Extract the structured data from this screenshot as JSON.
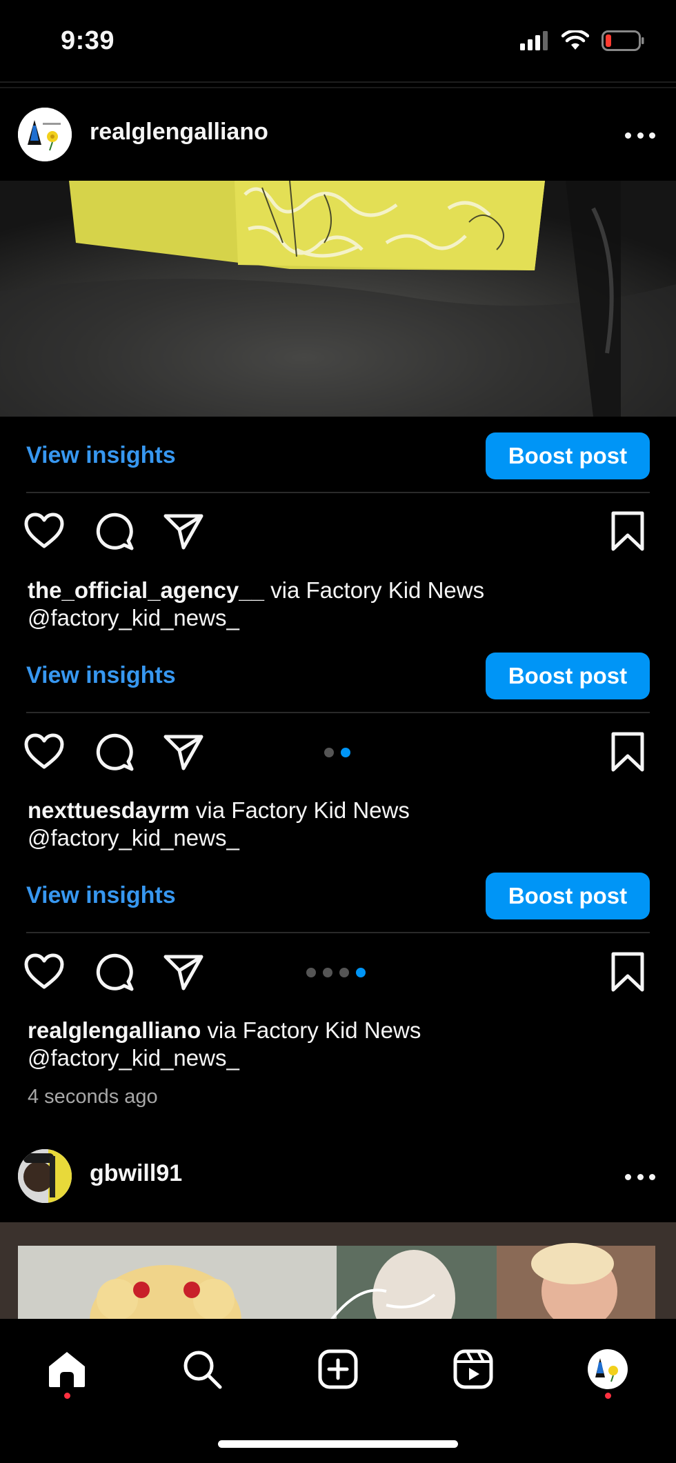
{
  "status_bar": {
    "time": "9:39"
  },
  "posts": [
    {
      "username": "realglengalliano"
    },
    {
      "username": "gbwill91"
    }
  ],
  "insights_rows": [
    {
      "view_label": "View insights",
      "boost_label": "Boost post"
    },
    {
      "view_label": "View insights",
      "boost_label": "Boost post"
    },
    {
      "view_label": "View insights",
      "boost_label": "Boost post"
    }
  ],
  "captions": [
    {
      "user": "the_official_agency__",
      "text": " via Factory Kid News",
      "handle": "@factory_kid_news_"
    },
    {
      "user": "nexttuesdayrm",
      "text": " via Factory Kid News",
      "handle": "@factory_kid_news_"
    },
    {
      "user": "realglengalliano",
      "text": " via Factory Kid News",
      "handle": "@factory_kid_news_"
    }
  ],
  "carousel_dots": [
    {
      "count": 2,
      "active_index": 1
    },
    {
      "count": 4,
      "active_index": 3
    }
  ],
  "timestamp": "4 seconds ago",
  "nav": {
    "items": [
      "home-icon",
      "search-icon",
      "create-icon",
      "reels-icon",
      "profile-avatar"
    ]
  },
  "colors": {
    "accent": "#0095f6",
    "link": "#3797f0",
    "notification": "#ff3040",
    "background": "#000000"
  }
}
